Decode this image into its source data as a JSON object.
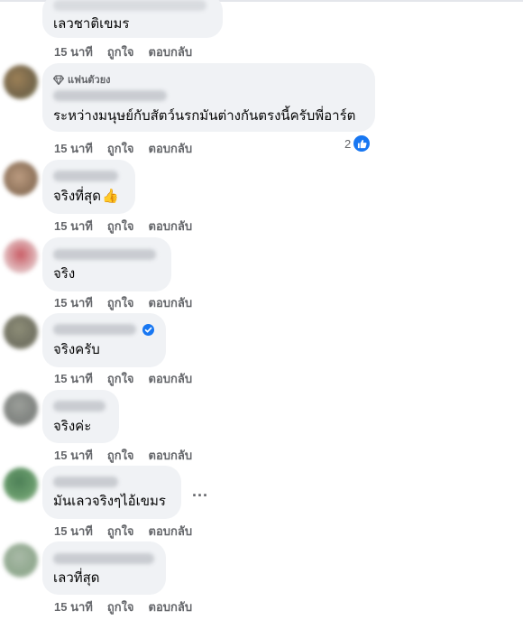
{
  "actions": {
    "like": "ถูกใจ",
    "reply": "ตอบกลับ"
  },
  "comments": [
    {
      "text": "เลวชาติเขมร",
      "time": "15 นาที"
    },
    {
      "badge": "แฟนตัวยง",
      "text": "ระหว่างมนุษย์กับสัตว์นรกมันต่างกันตรงนี้ครับพี่อาร์ต",
      "time": "15 นาที",
      "reaction_count": "2"
    },
    {
      "text": "จริงที่สุด",
      "emoji": "👍",
      "time": "15 นาที"
    },
    {
      "text": "จริง",
      "time": "15 นาที"
    },
    {
      "text": "จริงครับ",
      "time": "15 นาที",
      "verified": true
    },
    {
      "text": "จริงค่ะ",
      "time": "15 นาที"
    },
    {
      "text": "มันเลวจริงๆไอ้เขมร",
      "time": "15 นาที",
      "more": "..."
    },
    {
      "text": "เลวที่สุด",
      "time": "15 นาที"
    }
  ],
  "colors": {
    "bubble": "#f0f2f5",
    "meta": "#65676b",
    "accent": "#1877f2"
  }
}
